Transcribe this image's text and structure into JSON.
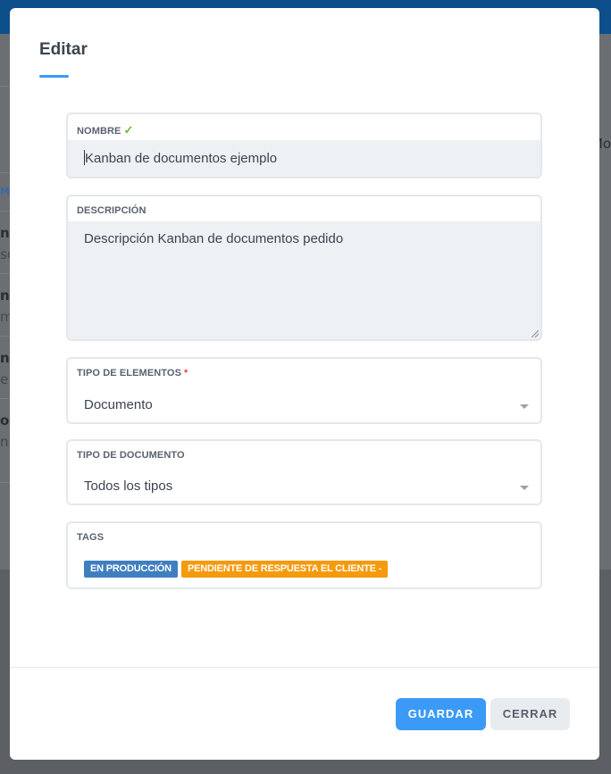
{
  "background": {
    "partial_texts": [
      "nk",
      "so",
      "nk",
      "m",
      "nk",
      "e",
      "oo",
      "nb"
    ],
    "right_text": "Mo",
    "link_text": "ME"
  },
  "modal": {
    "title": "Editar",
    "fields": {
      "nombre": {
        "label": "NOMBRE",
        "check": "✓",
        "value": "Kanban de documentos ejemplo"
      },
      "descripcion": {
        "label": "DESCRIPCIÓN",
        "value": "Descripción Kanban de documentos pedido"
      },
      "tipo_elementos": {
        "label": "TIPO DE ELEMENTOS",
        "required_mark": "*",
        "value": "Documento"
      },
      "tipo_documento": {
        "label": "TIPO DE DOCUMENTO",
        "value": "Todos los tipos"
      },
      "tags": {
        "label": "TAGS",
        "items": [
          "EN PRODUCCIÓN",
          "PENDIENTE DE RESPUESTA EL CLIENTE -"
        ]
      }
    },
    "buttons": {
      "save": "GUARDAR",
      "close": "CERRAR"
    }
  },
  "colors": {
    "accent": "#3b9af5",
    "tag_blue": "#3f7fc0",
    "tag_orange": "#f59a0c",
    "check_green": "#6bbf2a",
    "required_red": "#e8453c"
  }
}
